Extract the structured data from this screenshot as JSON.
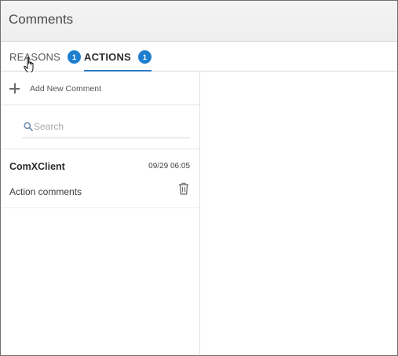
{
  "window": {
    "title": "Comments"
  },
  "tabs": [
    {
      "label": "REASONS",
      "badge": "1",
      "active": false
    },
    {
      "label": "ACTIONS",
      "badge": "1",
      "active": true
    }
  ],
  "colors": {
    "accent": "#2a7bc3",
    "badge": "#1f7fcf"
  },
  "left_panel": {
    "add_label": "Add New Comment",
    "search": {
      "placeholder": "Search",
      "value": ""
    },
    "comments": [
      {
        "author": "ComXClient",
        "timestamp": "09/29 06:05",
        "text": "Action comments"
      }
    ]
  },
  "icons": [
    "plus-icon",
    "search-icon",
    "trash-icon",
    "hand-cursor-icon"
  ]
}
